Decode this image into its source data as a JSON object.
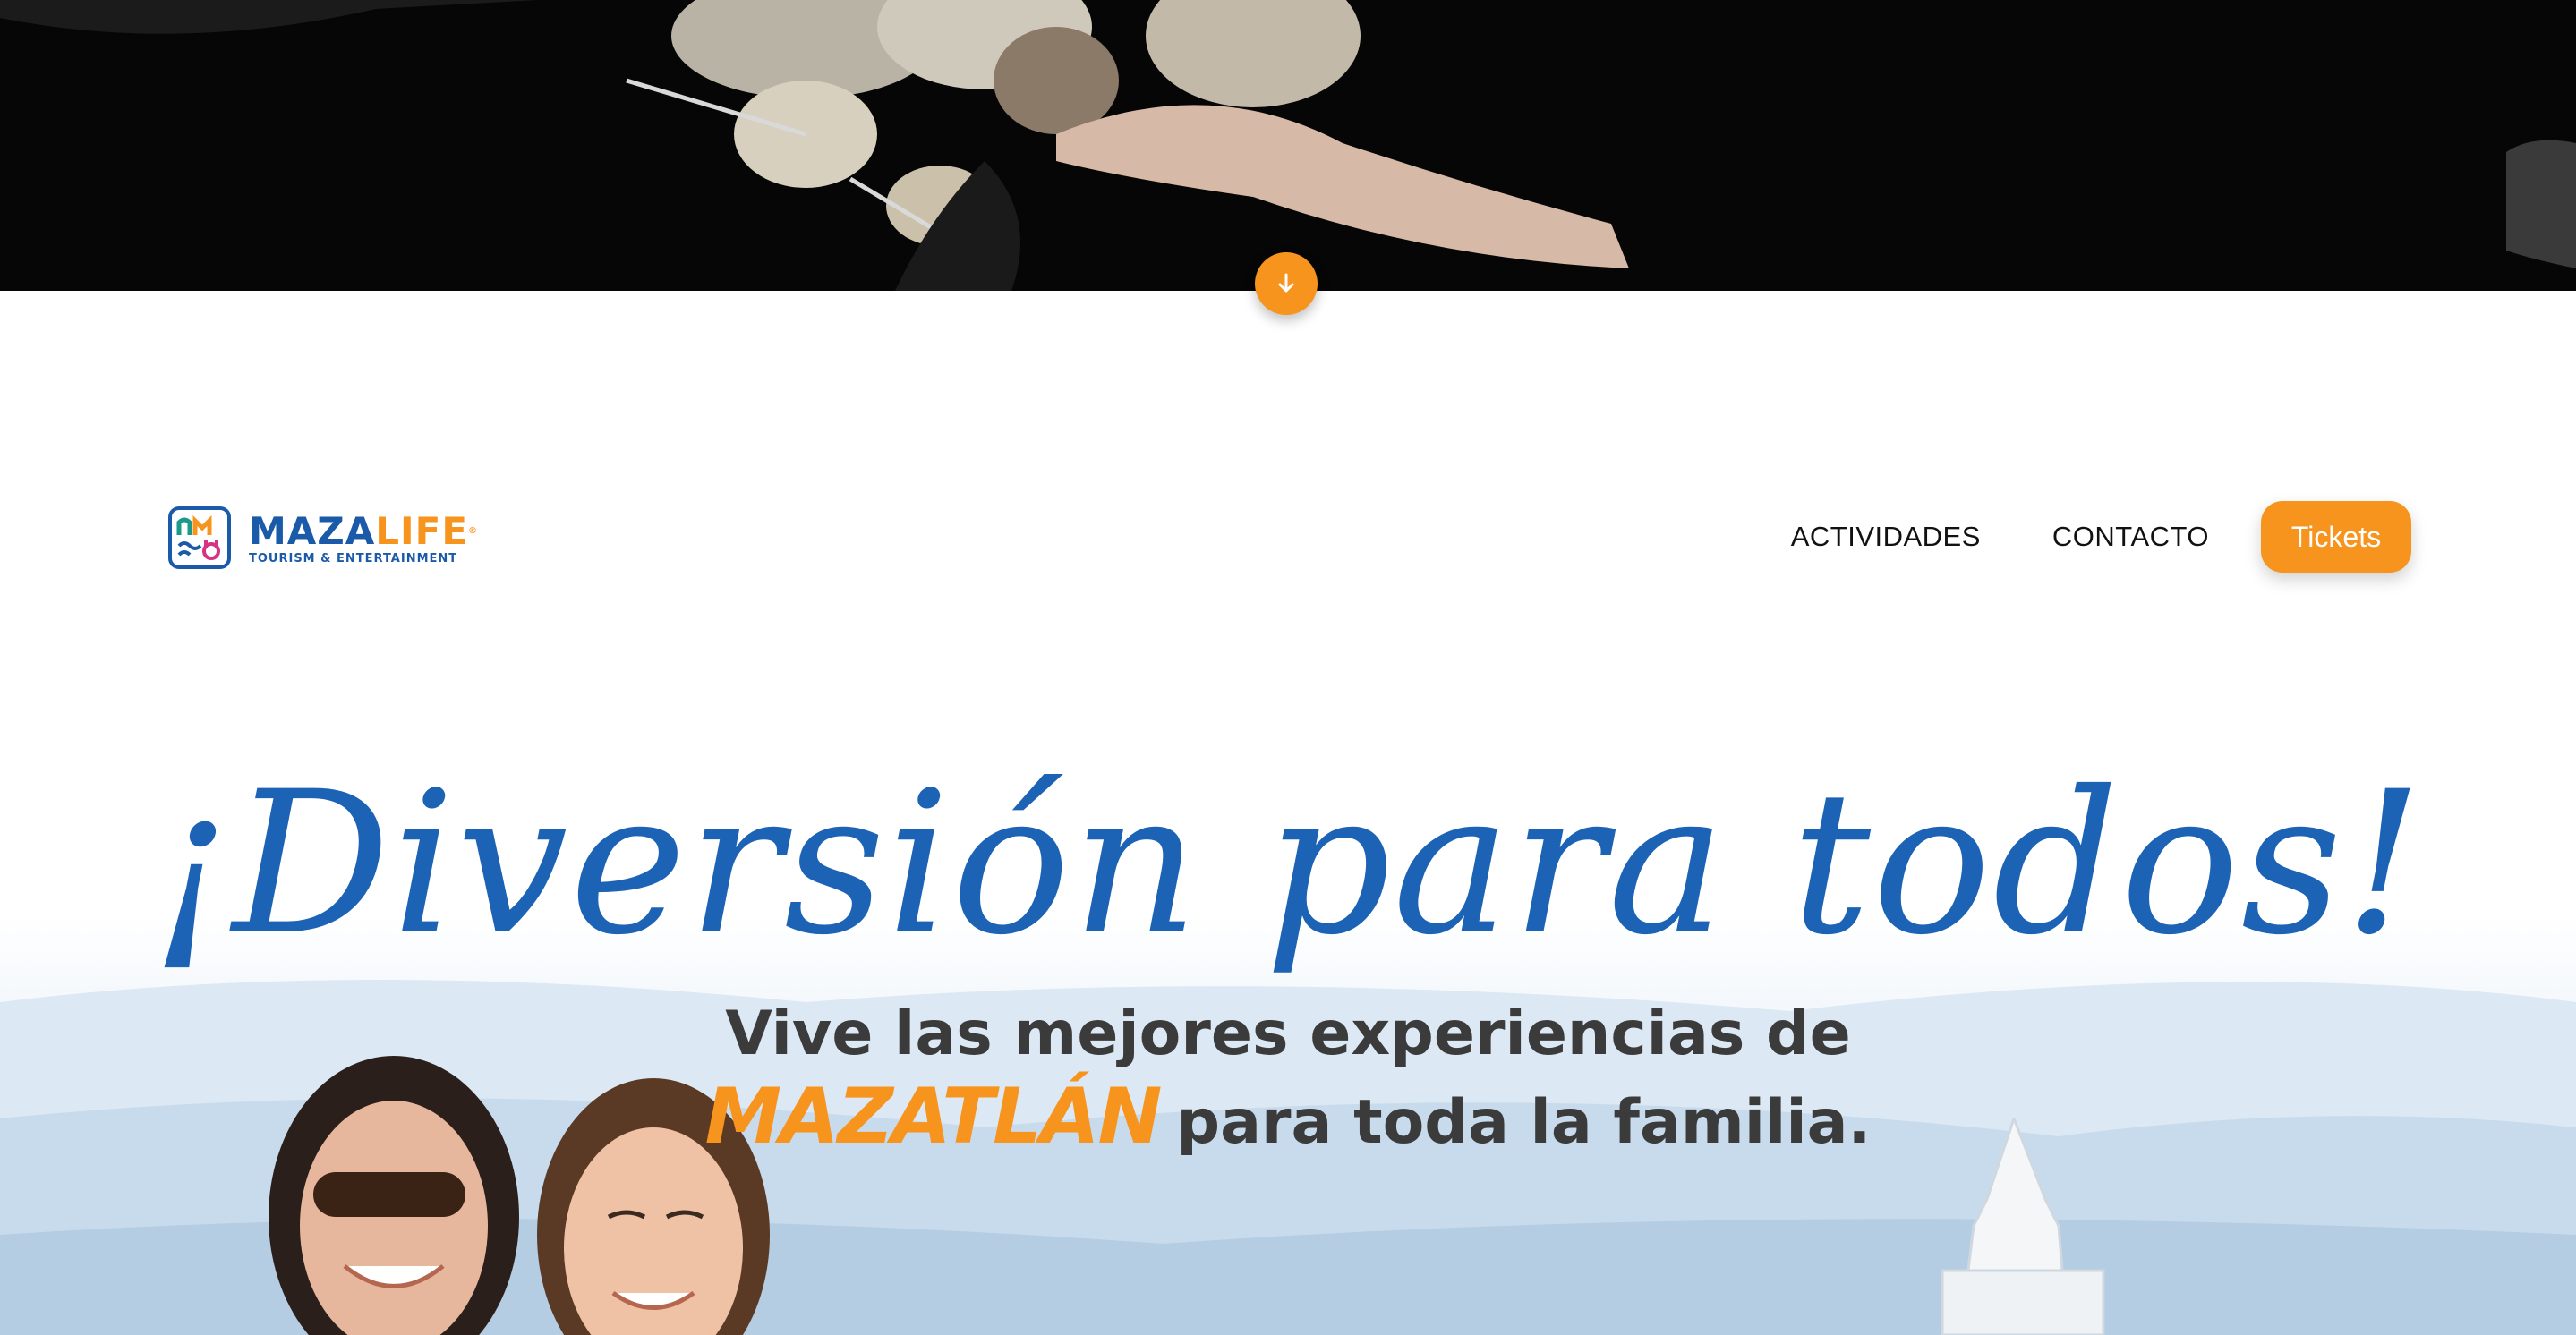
{
  "scroll_down": {
    "icon": "arrow-down-icon"
  },
  "brand": {
    "name_part1": "MAZA",
    "name_part2": "LIFE",
    "registered": "®",
    "tagline": "TOURISM & ENTERTAINMENT",
    "colors": {
      "blue": "#1a5aa8",
      "orange": "#f7941d"
    }
  },
  "nav": {
    "items": [
      {
        "label": "ACTIVIDADES"
      },
      {
        "label": "CONTACTO"
      }
    ],
    "cta_label": "Tickets"
  },
  "hero": {
    "title": "¡Diversión para todos!",
    "subtitle_line1": "Vive las mejores experiencias de",
    "subtitle_city": "MAZATLÁN",
    "subtitle_line2_rest": "para toda la familia."
  }
}
